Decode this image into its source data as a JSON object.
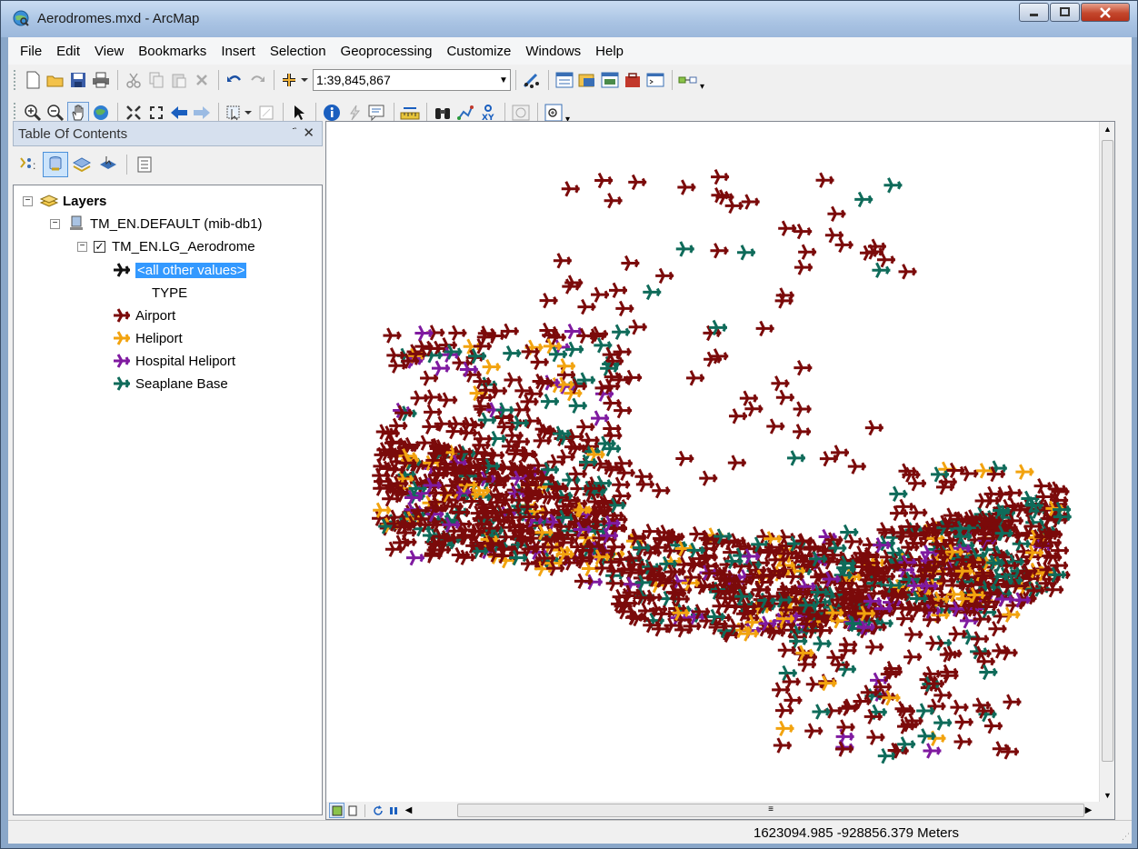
{
  "window": {
    "title": "Aerodromes.mxd - ArcMap"
  },
  "menu": [
    "File",
    "Edit",
    "View",
    "Bookmarks",
    "Insert",
    "Selection",
    "Geoprocessing",
    "Customize",
    "Windows",
    "Help"
  ],
  "toolbar": {
    "scale_value": "1:39,845,867"
  },
  "toc": {
    "title": "Table Of Contents",
    "pin_glyph": "҄",
    "close_glyph": "✕",
    "layers_label": "Layers",
    "database_label": "TM_EN.DEFAULT (mib-db1)",
    "layer_label": "TM_EN.LG_Aerodrome",
    "default_symbol_label": "<all other values>",
    "field_label": "TYPE",
    "classes": [
      {
        "label": "Airport",
        "color": "#7b0a0a"
      },
      {
        "label": "Heliport",
        "color": "#f2a30f"
      },
      {
        "label": "Hospital Heliport",
        "color": "#7f1aa0"
      },
      {
        "label": "Seaplane Base",
        "color": "#0f6b5a"
      }
    ],
    "default_symbol_color": "#111111"
  },
  "map": {
    "background": "#ffffff"
  },
  "status": {
    "coordinates": "1623094.985  -928856.379 Meters"
  }
}
